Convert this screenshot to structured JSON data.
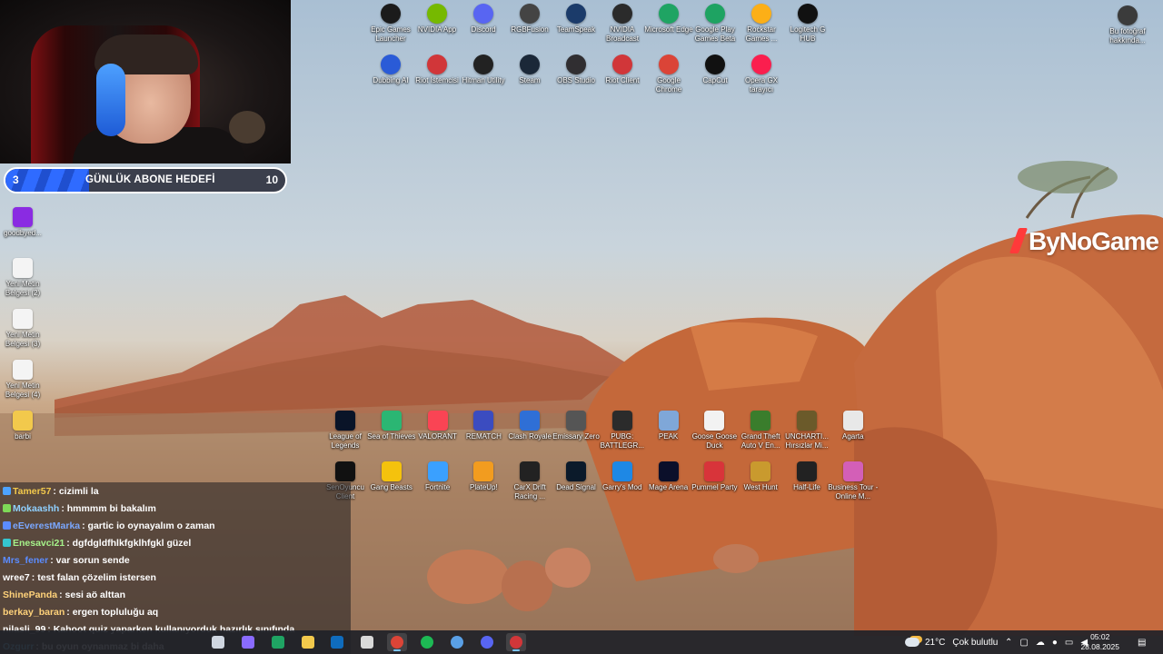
{
  "webcam": {
    "label": "streamer webcam"
  },
  "goal": {
    "current": "3",
    "label": "GÜNLÜK ABONE HEDEFİ",
    "target": "10",
    "progress": 0.3
  },
  "desktop_icons_top": [
    {
      "label": "Epic Games Launcher",
      "icon": "epic-games-icon",
      "color": "#1b1b1b"
    },
    {
      "label": "NVIDIA App",
      "icon": "nvidia-icon",
      "color": "#76b900"
    },
    {
      "label": "Discord",
      "icon": "discord-icon",
      "color": "#5865f2"
    },
    {
      "label": "RGBFusion",
      "icon": "rgbfusion-icon",
      "color": "#444"
    },
    {
      "label": "TeamSpeak",
      "icon": "teamspeak-icon",
      "color": "#1b3b6a"
    },
    {
      "label": "NVIDIA Broadcast",
      "icon": "nvidia-broadcast-icon",
      "color": "#2b2b2b"
    },
    {
      "label": "Microsoft Edge",
      "icon": "edge-icon",
      "color": "#1fa463"
    },
    {
      "label": "Google Play Games Beta",
      "icon": "google-play-games-icon",
      "color": "#1ea362"
    },
    {
      "label": "Rockstar Games ...",
      "icon": "rockstar-icon",
      "color": "#fcaf17"
    },
    {
      "label": "Logitech G HUB",
      "icon": "logitech-icon",
      "color": "#111"
    }
  ],
  "desktop_icons_top2": [
    {
      "label": "Dubbing AI",
      "icon": "dubbing-ai-icon",
      "color": "#2a5bd7"
    },
    {
      "label": "Riot İstemcisi",
      "icon": "riot-client-icon",
      "color": "#d13639"
    },
    {
      "label": "Hitman Utility",
      "icon": "hitman-utility-icon",
      "color": "#222"
    },
    {
      "label": "Steam",
      "icon": "steam-icon",
      "color": "#1b2838"
    },
    {
      "label": "OBS Studio",
      "icon": "obs-icon",
      "color": "#302e31"
    },
    {
      "label": "Riot Client",
      "icon": "riot-client2-icon",
      "color": "#d13639"
    },
    {
      "label": "Google Chrome",
      "icon": "chrome-icon",
      "color": "#db4437"
    },
    {
      "label": "CapCut",
      "icon": "capcut-icon",
      "color": "#111"
    },
    {
      "label": "Opera GX tarayıcı",
      "icon": "opera-gx-icon",
      "color": "#fa1e4e"
    }
  ],
  "desktop_icons_left": [
    {
      "label": "goodbyed...",
      "icon": "winrar-icon",
      "color": "#8a2be2"
    },
    {
      "label": "Yeni Metin Belgesi (2)",
      "icon": "text-file-icon",
      "color": "#f4f4f4"
    },
    {
      "label": "Yeni Metin Belgesi (3)",
      "icon": "text-file-icon",
      "color": "#f4f4f4"
    },
    {
      "label": "Yeni Metin Belgesi (4)",
      "icon": "text-file-icon",
      "color": "#f4f4f4"
    },
    {
      "label": "barbi",
      "icon": "folder-icon",
      "color": "#f2c94c"
    }
  ],
  "desktop_icon_right": {
    "label": "Bu fotoğraf hakkında...",
    "icon": "photo-info-icon",
    "color": "#3b3b3b"
  },
  "desktop_icons_games1": [
    {
      "label": "League of Legends",
      "icon": "league-icon",
      "color": "#0a1428"
    },
    {
      "label": "Sea of Thieves",
      "icon": "sea-of-thieves-icon",
      "color": "#2bb673"
    },
    {
      "label": "VALORANT",
      "icon": "valorant-icon",
      "color": "#fa4454"
    },
    {
      "label": "REMATCH",
      "icon": "rematch-icon",
      "color": "#3b4cc0"
    },
    {
      "label": "Clash Royale",
      "icon": "clash-royale-icon",
      "color": "#2f6fd6"
    },
    {
      "label": "Emissary Zero",
      "icon": "emissary-zero-icon",
      "color": "#555"
    },
    {
      "label": "PUBG: BATTLEGR...",
      "icon": "pubg-icon",
      "color": "#2b2b2b"
    },
    {
      "label": "PEAK",
      "icon": "peak-icon",
      "color": "#7fa7d8"
    },
    {
      "label": "Goose Goose Duck",
      "icon": "goose-goose-duck-icon",
      "color": "#f2f2f2"
    },
    {
      "label": "Grand Theft Auto V En...",
      "icon": "gta-icon",
      "color": "#3a7d2c"
    },
    {
      "label": "UNCHARTI... Hırsızlar Mi...",
      "icon": "uncharted-icon",
      "color": "#6b5a2a"
    },
    {
      "label": "Agarta",
      "icon": "agarta-icon",
      "color": "#e8e8e8"
    }
  ],
  "desktop_icons_games2": [
    {
      "label": "SenOyuncu Client",
      "icon": "senoyuncu-icon",
      "color": "#111"
    },
    {
      "label": "Gang Beasts",
      "icon": "gang-beasts-icon",
      "color": "#f4c20d"
    },
    {
      "label": "Fortnite",
      "icon": "fortnite-icon",
      "color": "#3aa0ff"
    },
    {
      "label": "PlateUp!",
      "icon": "plateup-icon",
      "color": "#f29c1f"
    },
    {
      "label": "CarX Drift Racing ...",
      "icon": "carx-icon",
      "color": "#222"
    },
    {
      "label": "Dead Signal",
      "icon": "dead-signal-icon",
      "color": "#0b1a2a"
    },
    {
      "label": "Garry's Mod",
      "icon": "garrys-mod-icon",
      "color": "#1e88e5"
    },
    {
      "label": "Mage Arena",
      "icon": "mage-arena-icon",
      "color": "#0b0f2a"
    },
    {
      "label": "Pummel Party",
      "icon": "pummel-party-icon",
      "color": "#d8343a"
    },
    {
      "label": "West Hunt",
      "icon": "west-hunt-icon",
      "color": "#c99a2e"
    },
    {
      "label": "Half-Life",
      "icon": "half-life-icon",
      "color": "#222"
    },
    {
      "label": "Business Tour - Online M...",
      "icon": "business-tour-icon",
      "color": "#d35fb7"
    }
  ],
  "watermark": {
    "text": "ByNoGame"
  },
  "chat": [
    {
      "user": "Tamer57",
      "color": "#f2c94c",
      "text": ": cizimli la"
    },
    {
      "user": "Mokaashh",
      "color": "#8fd0ff",
      "text": ": hmmmm bi bakalım"
    },
    {
      "user": "eEverestMarka",
      "color": "#7aa7ff",
      "text": ": gartic io oynayalım o zaman"
    },
    {
      "user": "Enesavci21",
      "color": "#a6f28a",
      "text": ": dgfdgldfhlkfgklhfgkl güzel"
    },
    {
      "user": "Mrs_fener",
      "color": "#5b8cff",
      "text": ": var sorun sende"
    },
    {
      "user": "wree7",
      "color": "#ffffff",
      "text": ": test falan çözelim istersen"
    },
    {
      "user": "ShinePanda",
      "color": "#ffd27a",
      "text": ": sesi aö alttan"
    },
    {
      "user": "berkay_baran",
      "color": "#ffd27a",
      "text": ": ergen topluluğu aq"
    },
    {
      "user": "nilasli_99",
      "color": "#ffffff",
      "text": ": Kahoot quiz yaparken kullanıyorduk hazırlık sınıfında"
    },
    {
      "user": "Ozgurr",
      "color": "#7fd3ff",
      "text": ": bu oyun oynanmaz bi daha"
    }
  ],
  "taskbar": {
    "apps": [
      {
        "name": "task-view-icon",
        "color": "#cfd6e0"
      },
      {
        "name": "copilot-icon",
        "color": "#8a6bff"
      },
      {
        "name": "edge-taskbar-icon",
        "color": "#1fa463"
      },
      {
        "name": "file-explorer-icon",
        "color": "#f2c94c"
      },
      {
        "name": "outlook-icon",
        "color": "#0f6cbd"
      },
      {
        "name": "xbox-icon",
        "color": "#d9d9d9"
      },
      {
        "name": "chrome-taskbar-icon",
        "color": "#db4437"
      },
      {
        "name": "spotify-icon",
        "color": "#1db954"
      },
      {
        "name": "settings-app-icon",
        "color": "#5aa0e6"
      },
      {
        "name": "discord-taskbar-icon",
        "color": "#5865f2"
      },
      {
        "name": "obs-taskbar-icon",
        "color": "#d13639"
      }
    ],
    "weather": {
      "temp": "21°C",
      "desc": "Çok bulutlu"
    },
    "time": "05:02",
    "date": "28.08.2025"
  }
}
